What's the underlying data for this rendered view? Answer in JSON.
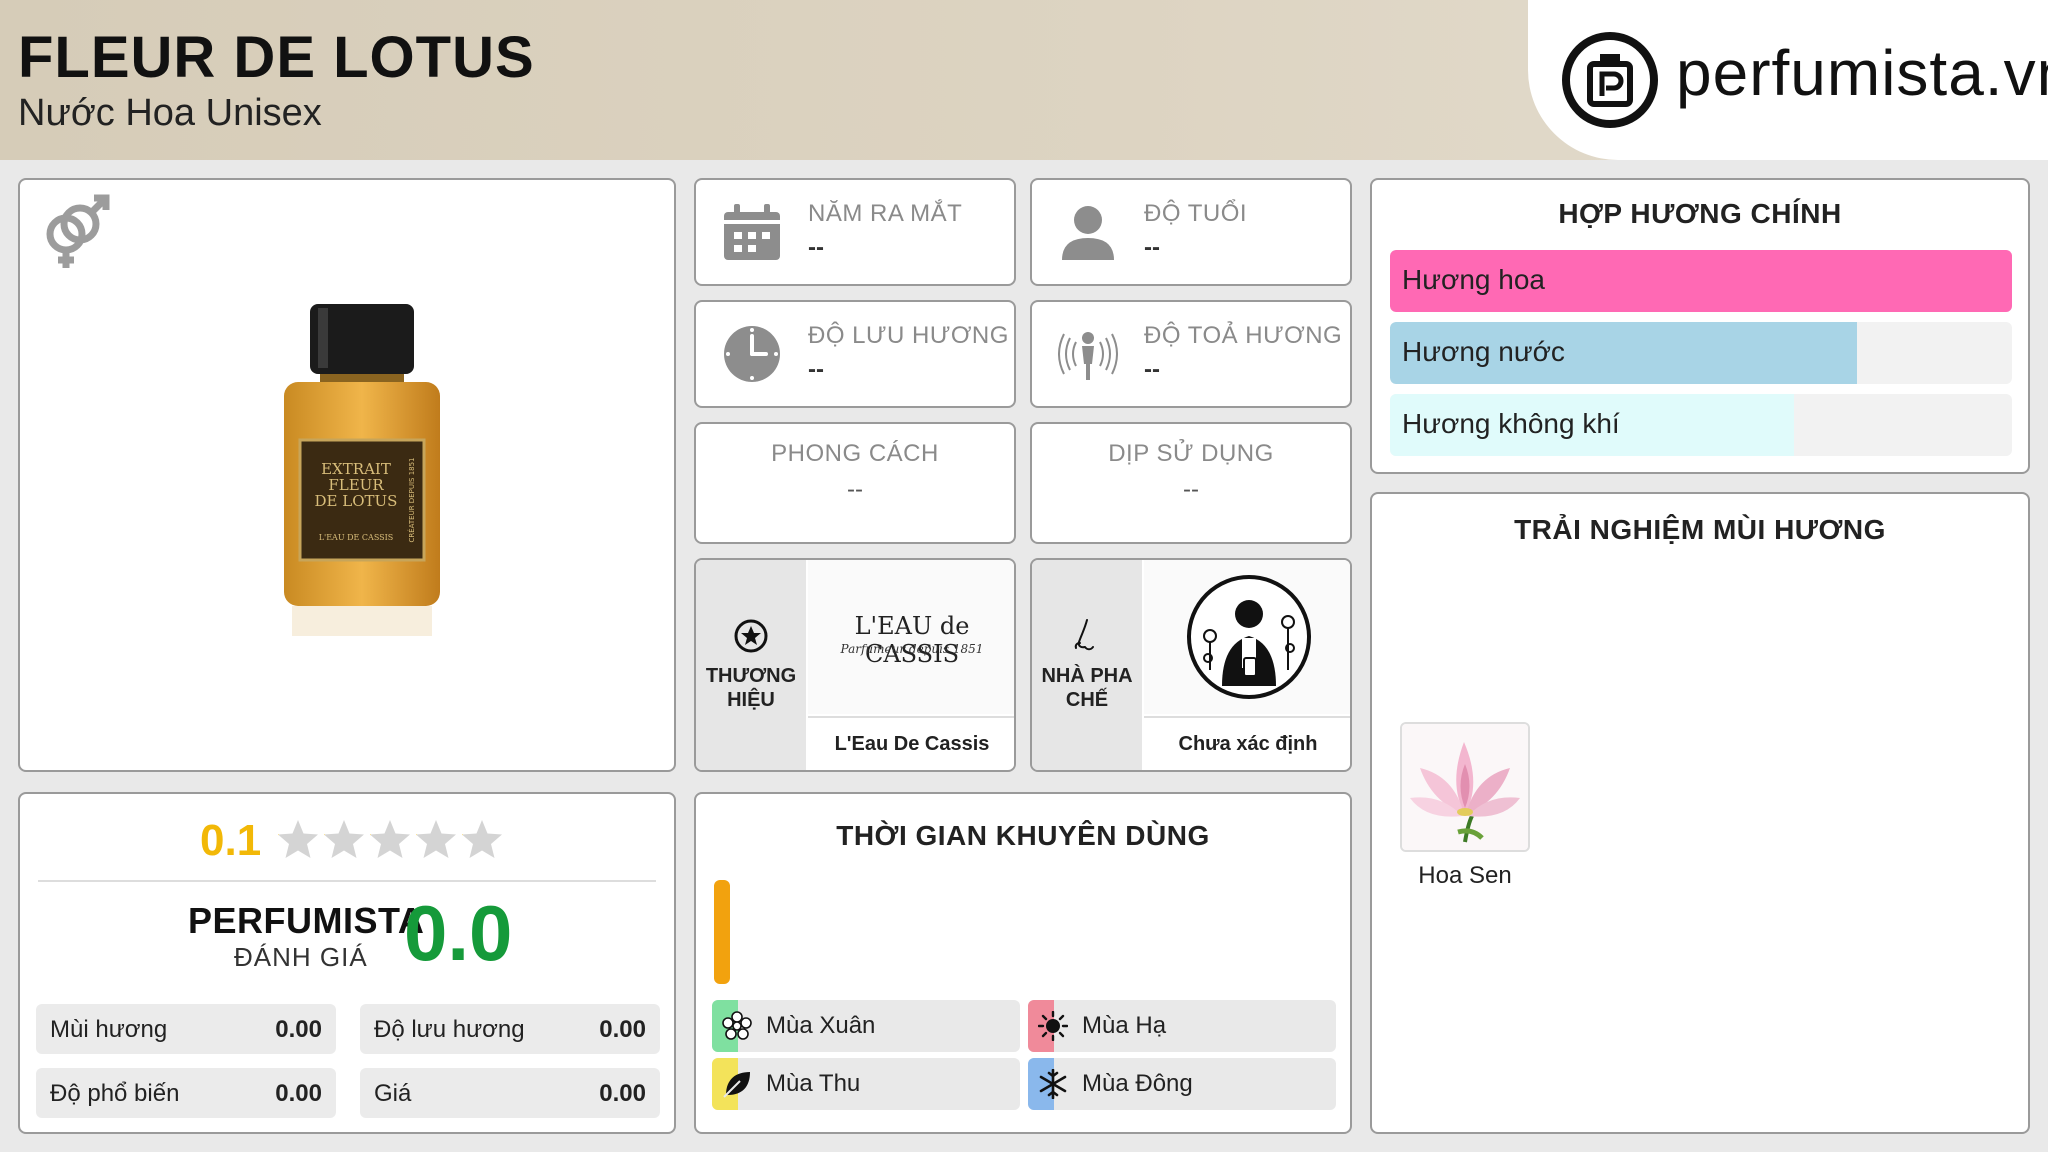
{
  "header": {
    "title": "FLEUR DE LOTUS",
    "subtitle": "Nước Hoa Unisex",
    "logo_text": "perfumista.vn"
  },
  "product": {
    "gender_icon": "unisex-icon",
    "bottle_label": [
      "EXTRAIT",
      "FLEUR",
      "DE LOTUS"
    ],
    "bottle_small": "L'EAU DE CASSIS",
    "bottle_side": "CRÉATEUR DEPUIS 1851"
  },
  "info": {
    "year": {
      "label": "NĂM RA MẮT",
      "value": "--",
      "icon": "calendar-icon"
    },
    "age": {
      "label": "ĐỘ TUỔI",
      "value": "--",
      "icon": "person-icon"
    },
    "longevity": {
      "label": "ĐỘ LƯU HƯƠNG",
      "value": "--",
      "icon": "clock-icon"
    },
    "sillage": {
      "label": "ĐỘ TOẢ HƯƠNG",
      "value": "--",
      "icon": "radiating-person-icon"
    },
    "style": {
      "label": "PHONG CÁCH",
      "value": "--"
    },
    "occasion": {
      "label": "DỊP SỬ DỤNG",
      "value": "--"
    }
  },
  "brand": {
    "label_line1": "THƯƠNG",
    "label_line2": "HIỆU",
    "logo_main": "L'EAU de CASSIS",
    "logo_sub": "Parfumeur depuis 1851",
    "name": "L'Eau De Cassis",
    "icon": "star-badge-icon"
  },
  "perfumer": {
    "label_line1": "NHÀ PHA",
    "label_line2": "CHẾ",
    "name": "Chưa xác định",
    "icon": "nose-icon"
  },
  "accords": {
    "title": "HỢP HƯƠNG CHÍNH",
    "items": [
      {
        "label": "Hương hoa",
        "level": 1.0,
        "color": "#ff69b4"
      },
      {
        "label": "Hương nước",
        "level": 0.75,
        "color": "#a8d4e6"
      },
      {
        "label": "Hương không khí",
        "level": 0.65,
        "color": "#e0fbfb"
      }
    ]
  },
  "notes": {
    "title": "TRẢI NGHIỆM MÙI HƯƠNG",
    "items": [
      {
        "label": "Hoa Sen"
      }
    ]
  },
  "rating": {
    "score": "0.1",
    "stars_filled": 0.02,
    "pf_title": "PERFUMISTA",
    "pf_sub": "ĐÁNH GIÁ",
    "pf_score": "0.0",
    "metrics": [
      {
        "label": "Mùi hương",
        "value": "0.00"
      },
      {
        "label": "Độ lưu hương",
        "value": "0.00"
      },
      {
        "label": "Độ phổ biến",
        "value": "0.00"
      },
      {
        "label": "Giá",
        "value": "0.00"
      }
    ]
  },
  "time": {
    "title": "THỜI GIAN KHUYÊN DÙNG",
    "seasons": [
      {
        "label": "Mùa Xuân",
        "color": "#7fe0a0",
        "icon": "flower-icon"
      },
      {
        "label": "Mùa Hạ",
        "color": "#f08a9a",
        "icon": "sun-icon"
      },
      {
        "label": "Mùa Thu",
        "color": "#f3e35a",
        "icon": "leaf-icon"
      },
      {
        "label": "Mùa Đông",
        "color": "#8ab8ec",
        "icon": "snowflake-icon"
      }
    ]
  }
}
